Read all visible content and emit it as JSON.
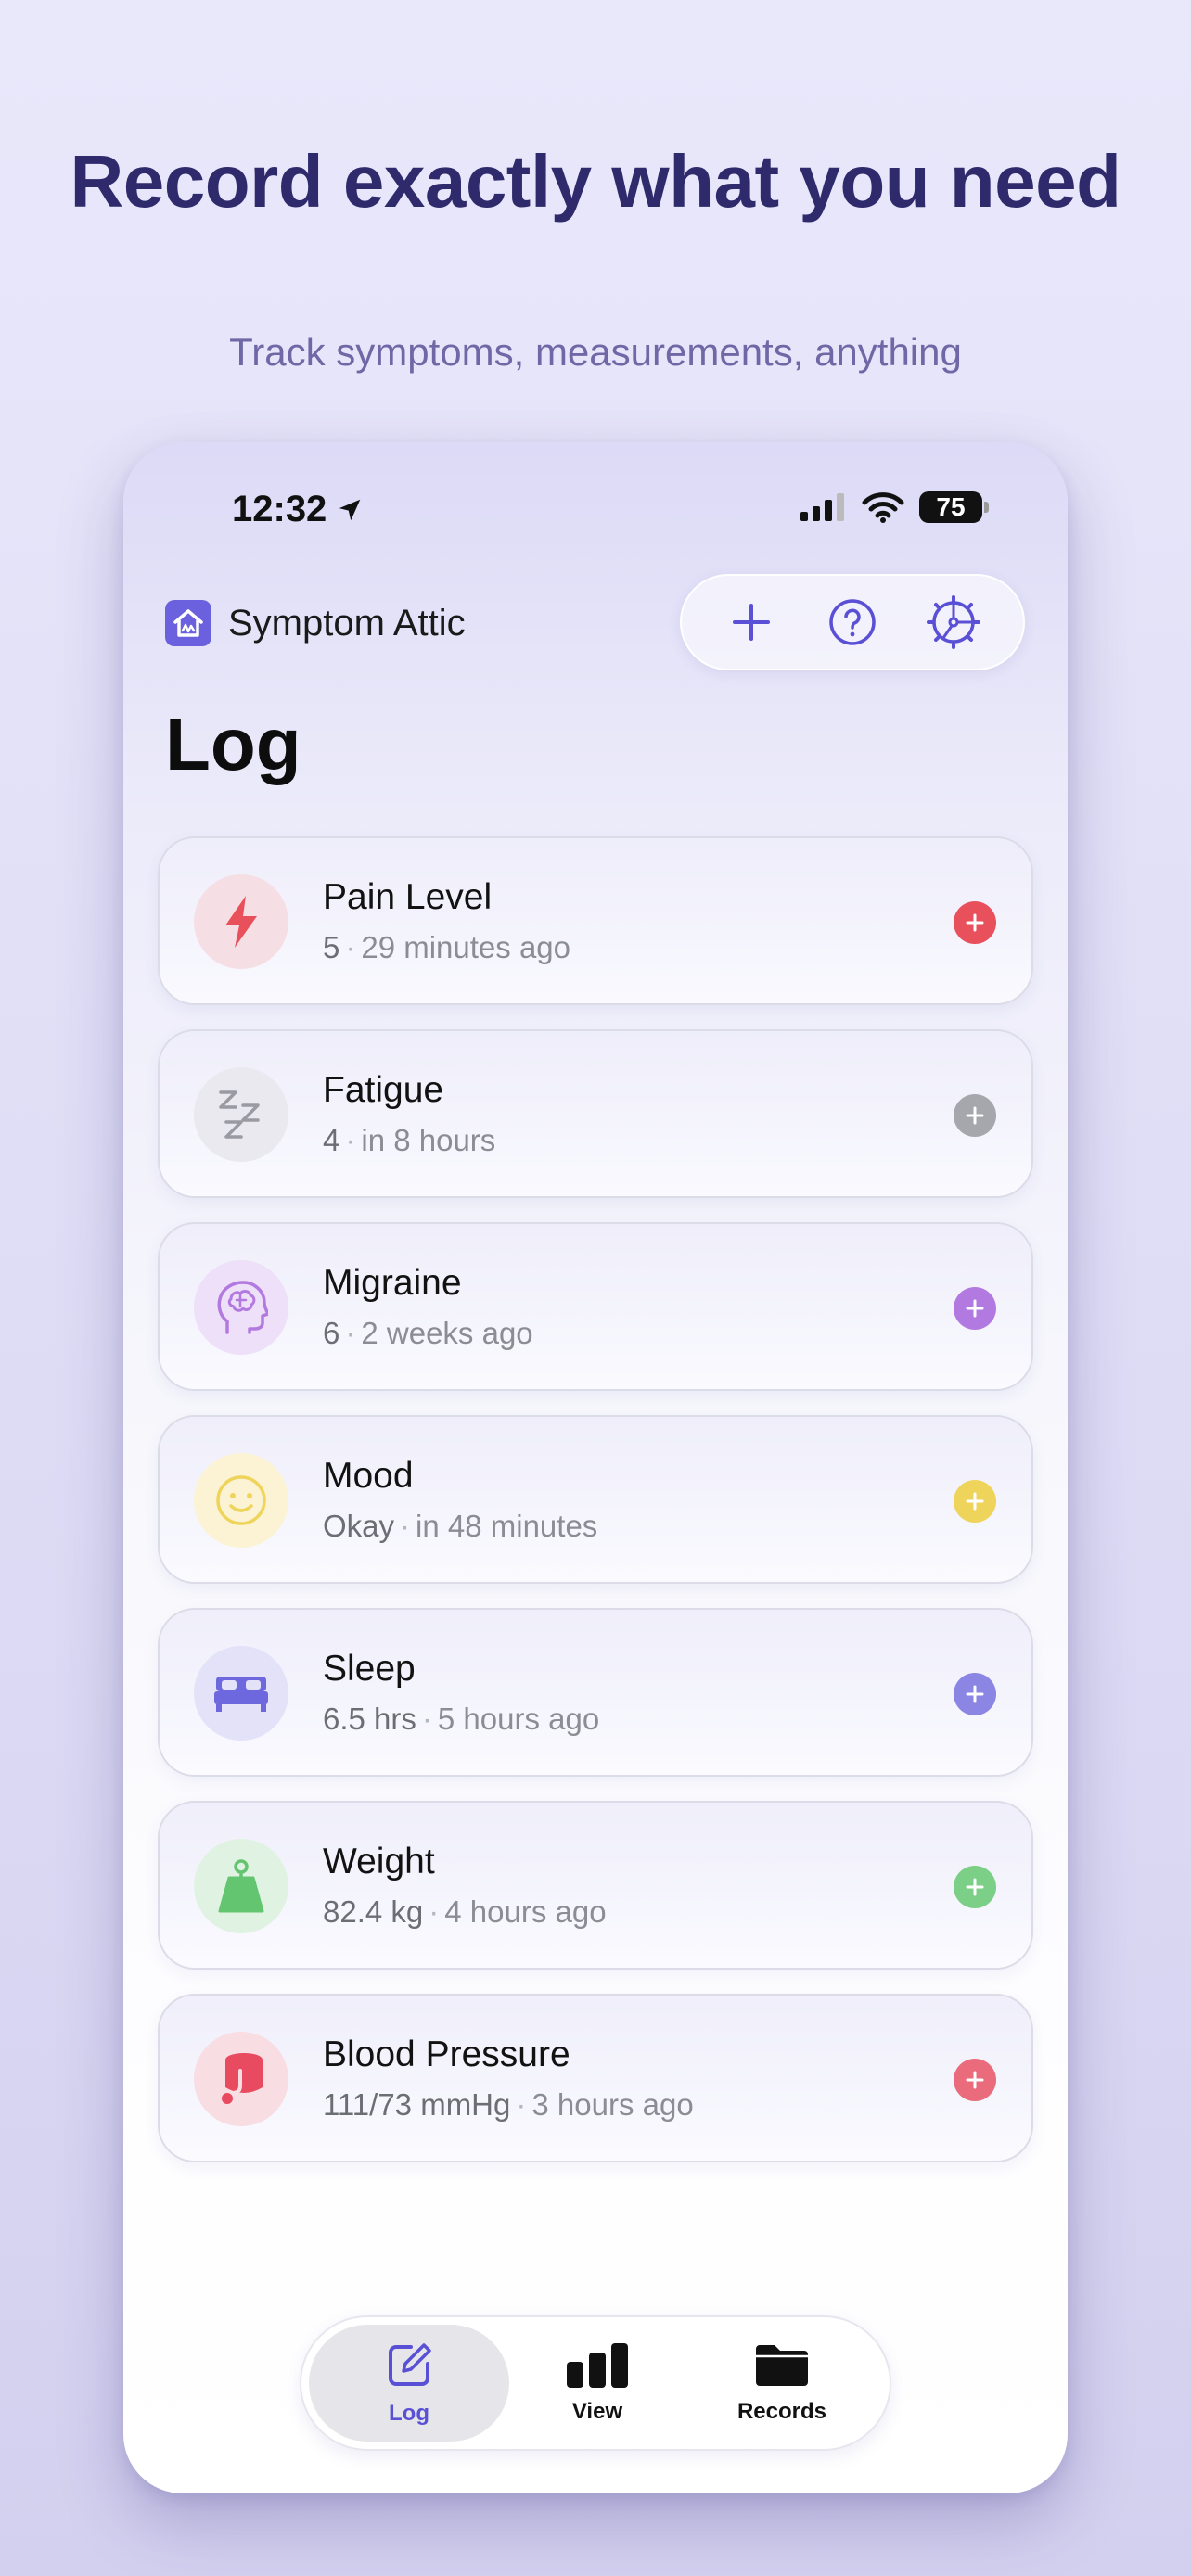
{
  "headline": "Record exactly what you need",
  "subheadline": "Track symptoms, measurements, anything",
  "status_bar": {
    "time": "12:32",
    "battery": "75"
  },
  "app": {
    "name": "Symptom Attic"
  },
  "toolbar": {
    "add_icon": "plus-icon",
    "help_icon": "help-icon",
    "settings_icon": "gear-icon"
  },
  "page_title": "Log",
  "entries": [
    {
      "name": "Pain Level",
      "value": "5",
      "time": "29 minutes ago",
      "icon": "lightning-icon",
      "accent": "#e8505b",
      "tint": "#f6dfe4"
    },
    {
      "name": "Fatigue",
      "value": "4",
      "time": "in 8 hours",
      "icon": "sleep-zzz-icon",
      "accent": "#9a9aa3",
      "tint": "#e9e9ef"
    },
    {
      "name": "Migraine",
      "value": "6",
      "time": "2 weeks ago",
      "icon": "brain-head-icon",
      "accent": "#b27ae0",
      "tint": "#ede0f8"
    },
    {
      "name": "Mood",
      "value": "Okay",
      "time": "in 48 minutes",
      "icon": "smiley-icon",
      "accent": "#efd45c",
      "tint": "#fbf3d4"
    },
    {
      "name": "Sleep",
      "value": "6.5 hrs",
      "time": "5 hours ago",
      "icon": "bed-icon",
      "accent": "#6e68de",
      "tint": "#e3e2f9"
    },
    {
      "name": "Weight",
      "value": "82.4 kg",
      "time": "4 hours ago",
      "icon": "scale-weight-icon",
      "accent": "#63c56f",
      "tint": "#e0f3e3"
    },
    {
      "name": "Blood Pressure",
      "value": "111/73 mmHg",
      "time": "3 hours ago",
      "icon": "blood-pressure-cuff-icon",
      "accent": "#e84a60",
      "tint": "#f8dde2"
    }
  ],
  "tabs": [
    {
      "label": "Log",
      "icon": "compose-icon",
      "active": true
    },
    {
      "label": "View",
      "icon": "bar-chart-icon",
      "active": false
    },
    {
      "label": "Records",
      "icon": "folder-icon",
      "active": false
    }
  ],
  "colors": {
    "brand": "#5a50d6",
    "headline": "#2f2a6b"
  }
}
